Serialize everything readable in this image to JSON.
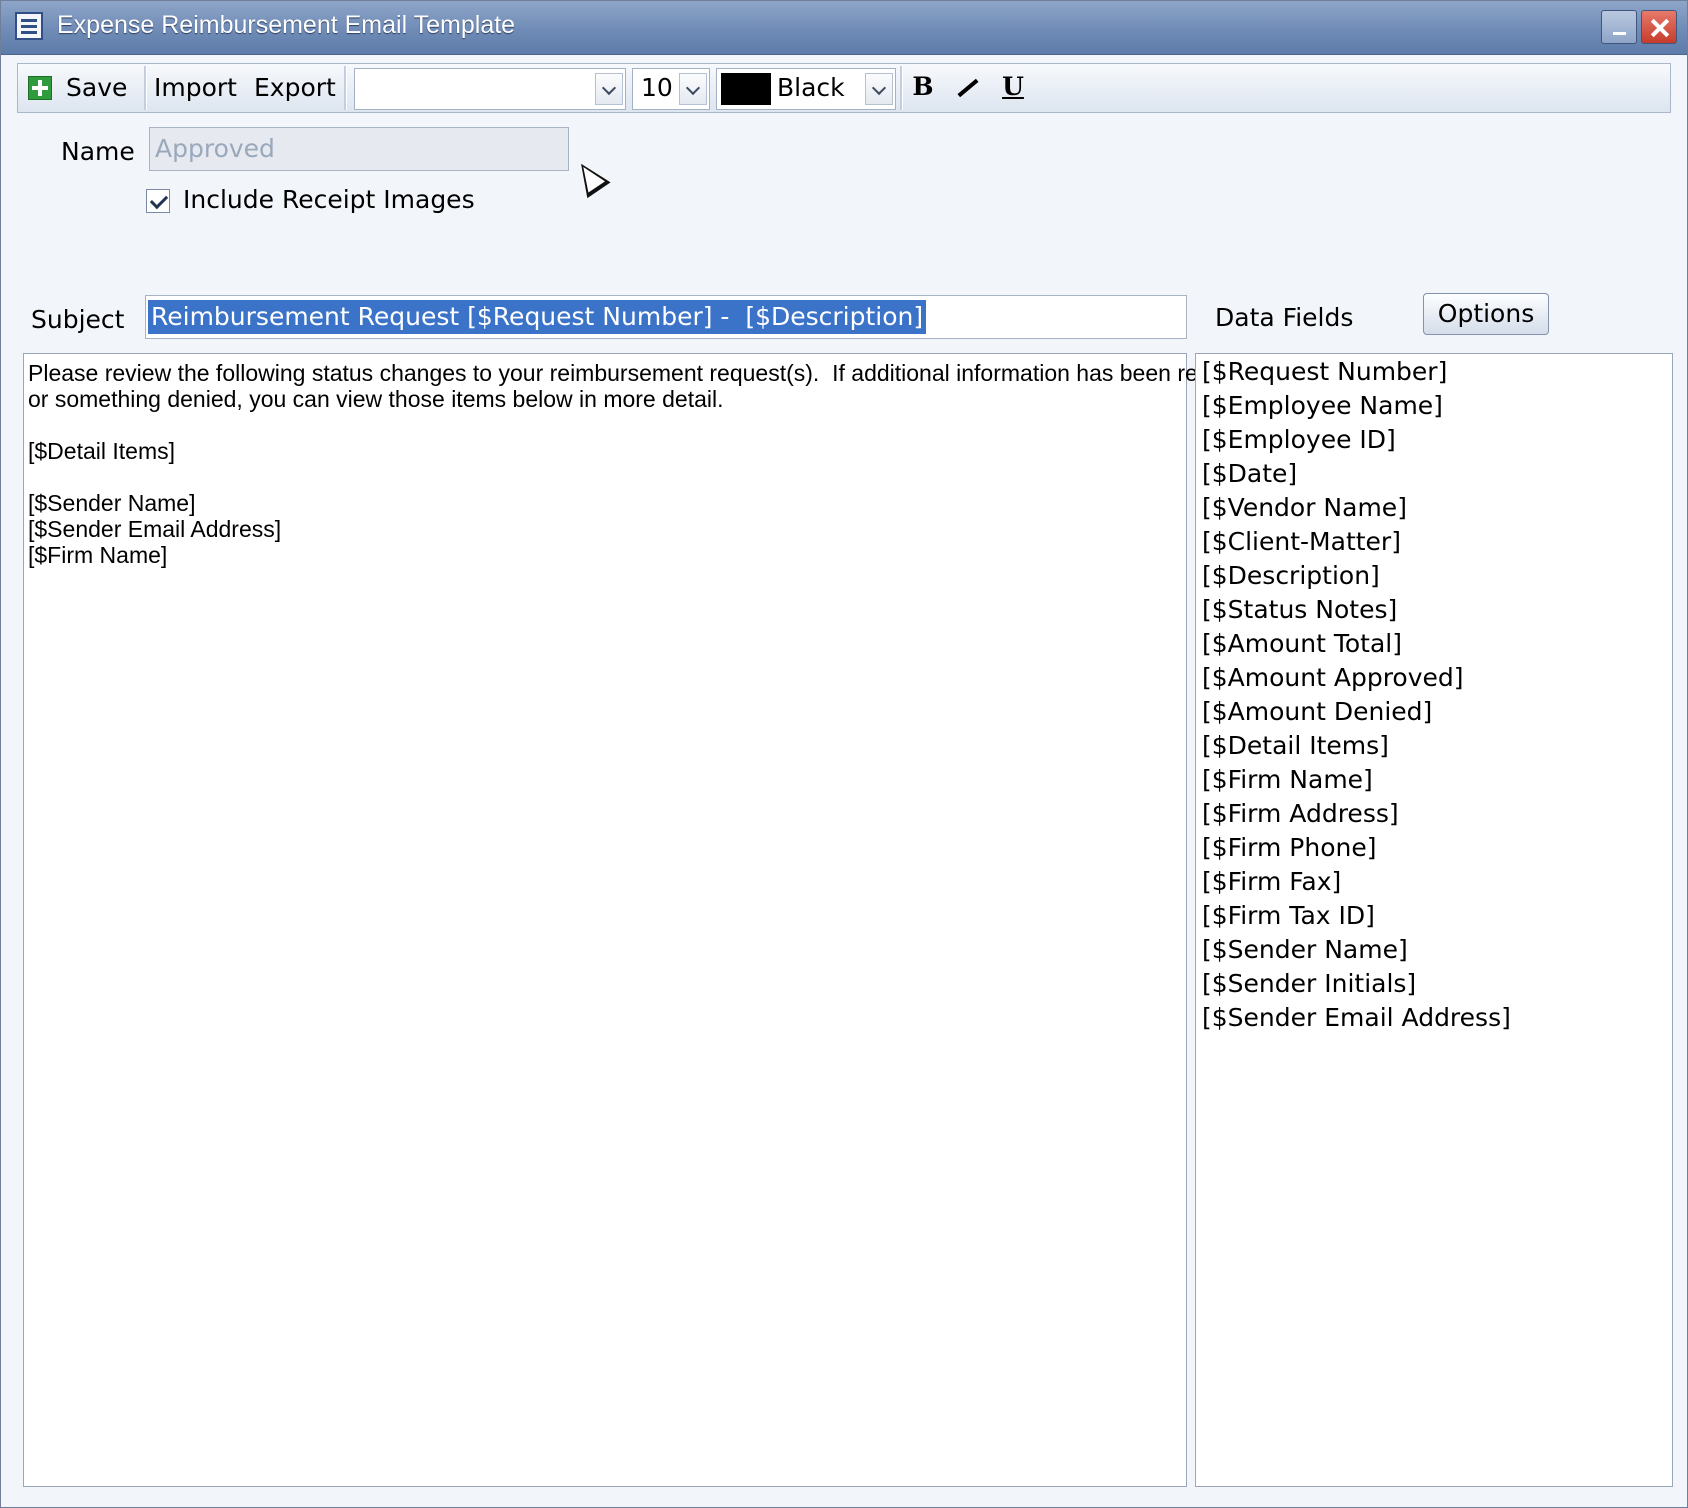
{
  "window": {
    "title": "Expense Reimbursement Email Template",
    "min_icon": "minimize-icon",
    "close_icon": "close-icon"
  },
  "toolbar": {
    "save_label": "Save",
    "import_label": "Import",
    "export_label": "Export",
    "font_value": "",
    "size_value": "10",
    "color_value": "Black",
    "color_swatch": "#000000",
    "bold_label": "B",
    "italic_label": "",
    "underline_label": "U"
  },
  "form": {
    "name_label": "Name",
    "name_value": "Approved",
    "include_receipts_label": "Include Receipt Images",
    "include_receipts_checked": true,
    "subject_label": "Subject",
    "subject_value": "Reimbursement Request [$Request Number] -  [$Description]"
  },
  "body": {
    "lines": [
      "Please review the following status changes to your reimbursement request(s).  If additional information has been requested",
      "or something denied, you can view those items below in more detail.",
      "",
      "[$Detail Items]",
      "",
      "[$Sender Name]",
      "[$Sender Email Address]",
      "[$Firm Name]"
    ]
  },
  "data_fields": {
    "label": "Data Fields",
    "options_label": "Options",
    "items": [
      "[$Request Number]",
      "[$Employee Name]",
      "[$Employee ID]",
      "[$Date]",
      "[$Vendor Name]",
      "[$Client-Matter]",
      "[$Description]",
      "[$Status Notes]",
      "[$Amount Total]",
      "[$Amount Approved]",
      "[$Amount Denied]",
      "[$Detail Items]",
      "[$Firm Name]",
      "[$Firm Address]",
      "[$Firm Phone]",
      "[$Firm Fax]",
      "[$Firm Tax ID]",
      "[$Sender Name]",
      "[$Sender Initials]",
      "[$Sender Email Address]"
    ]
  }
}
